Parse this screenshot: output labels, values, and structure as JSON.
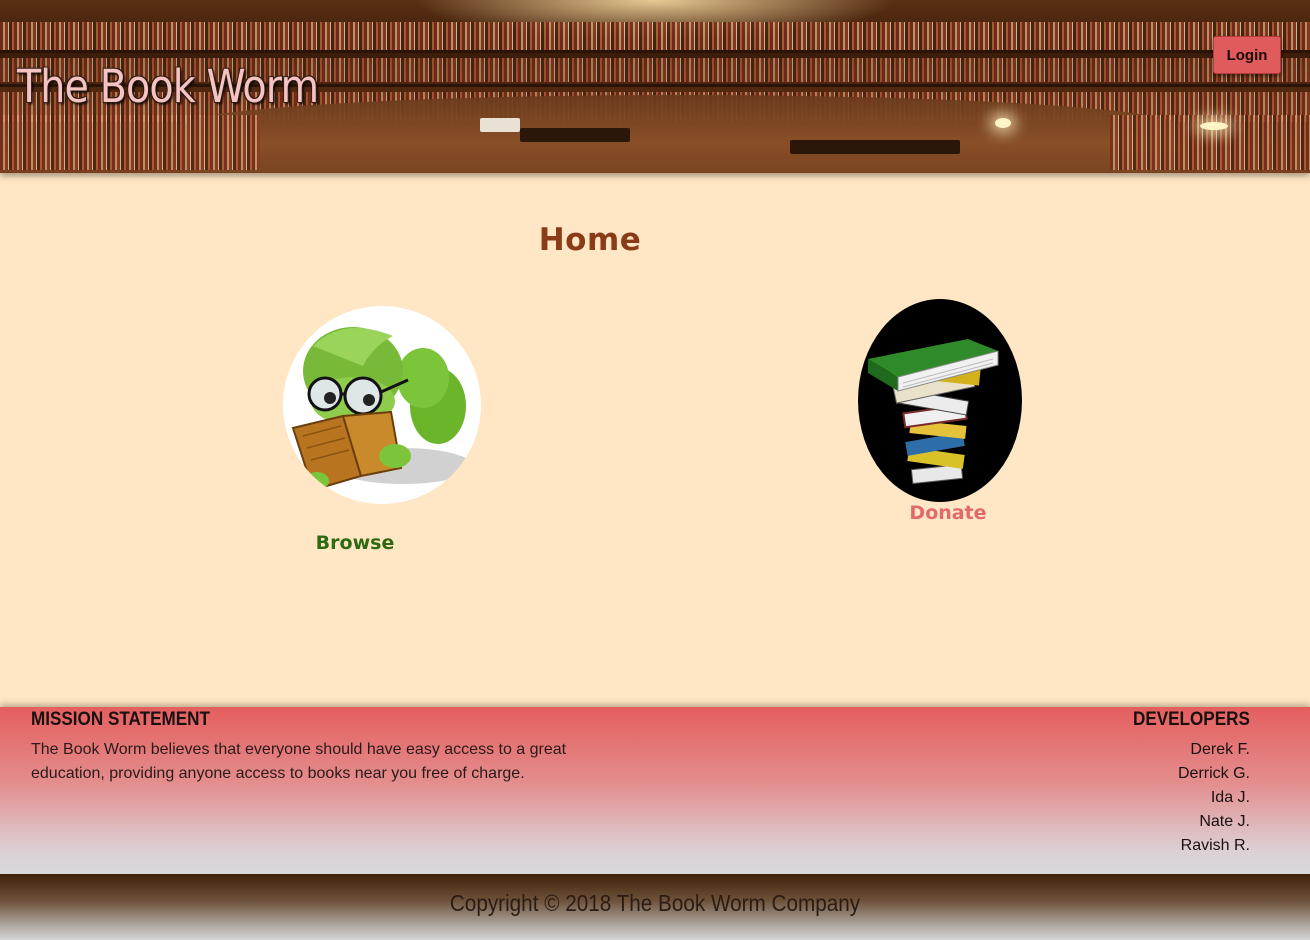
{
  "header": {
    "site_title": "The Book Worm",
    "login_label": "Login"
  },
  "main": {
    "title": "Home",
    "browse_label": "Browse",
    "donate_label": "Donate"
  },
  "footer": {
    "mission_heading": "MISSION STATEMENT",
    "mission_text": "The Book Worm believes that everyone should have easy access to a great education, providing anyone access to books near you free of charge.",
    "developers_heading": "DEVELOPERS",
    "developers": [
      "Derek F.",
      "Derrick G.",
      "Ida J.",
      "Nate J.",
      "Ravish R."
    ],
    "copyright": "Copyright © 2018 The Book Worm Company"
  },
  "colors": {
    "page_background": "#ffe6c4",
    "title": "#8a3b17",
    "browse": "#2f6a12",
    "donate": "#e06a6a",
    "login_button": "#e05b5b",
    "footer_top": "#e55e5e"
  },
  "images": {
    "header_background": "library-interior-photo",
    "browse_image": "bookworm-reading-illustration",
    "donate_image": "book-stack-illustration"
  }
}
